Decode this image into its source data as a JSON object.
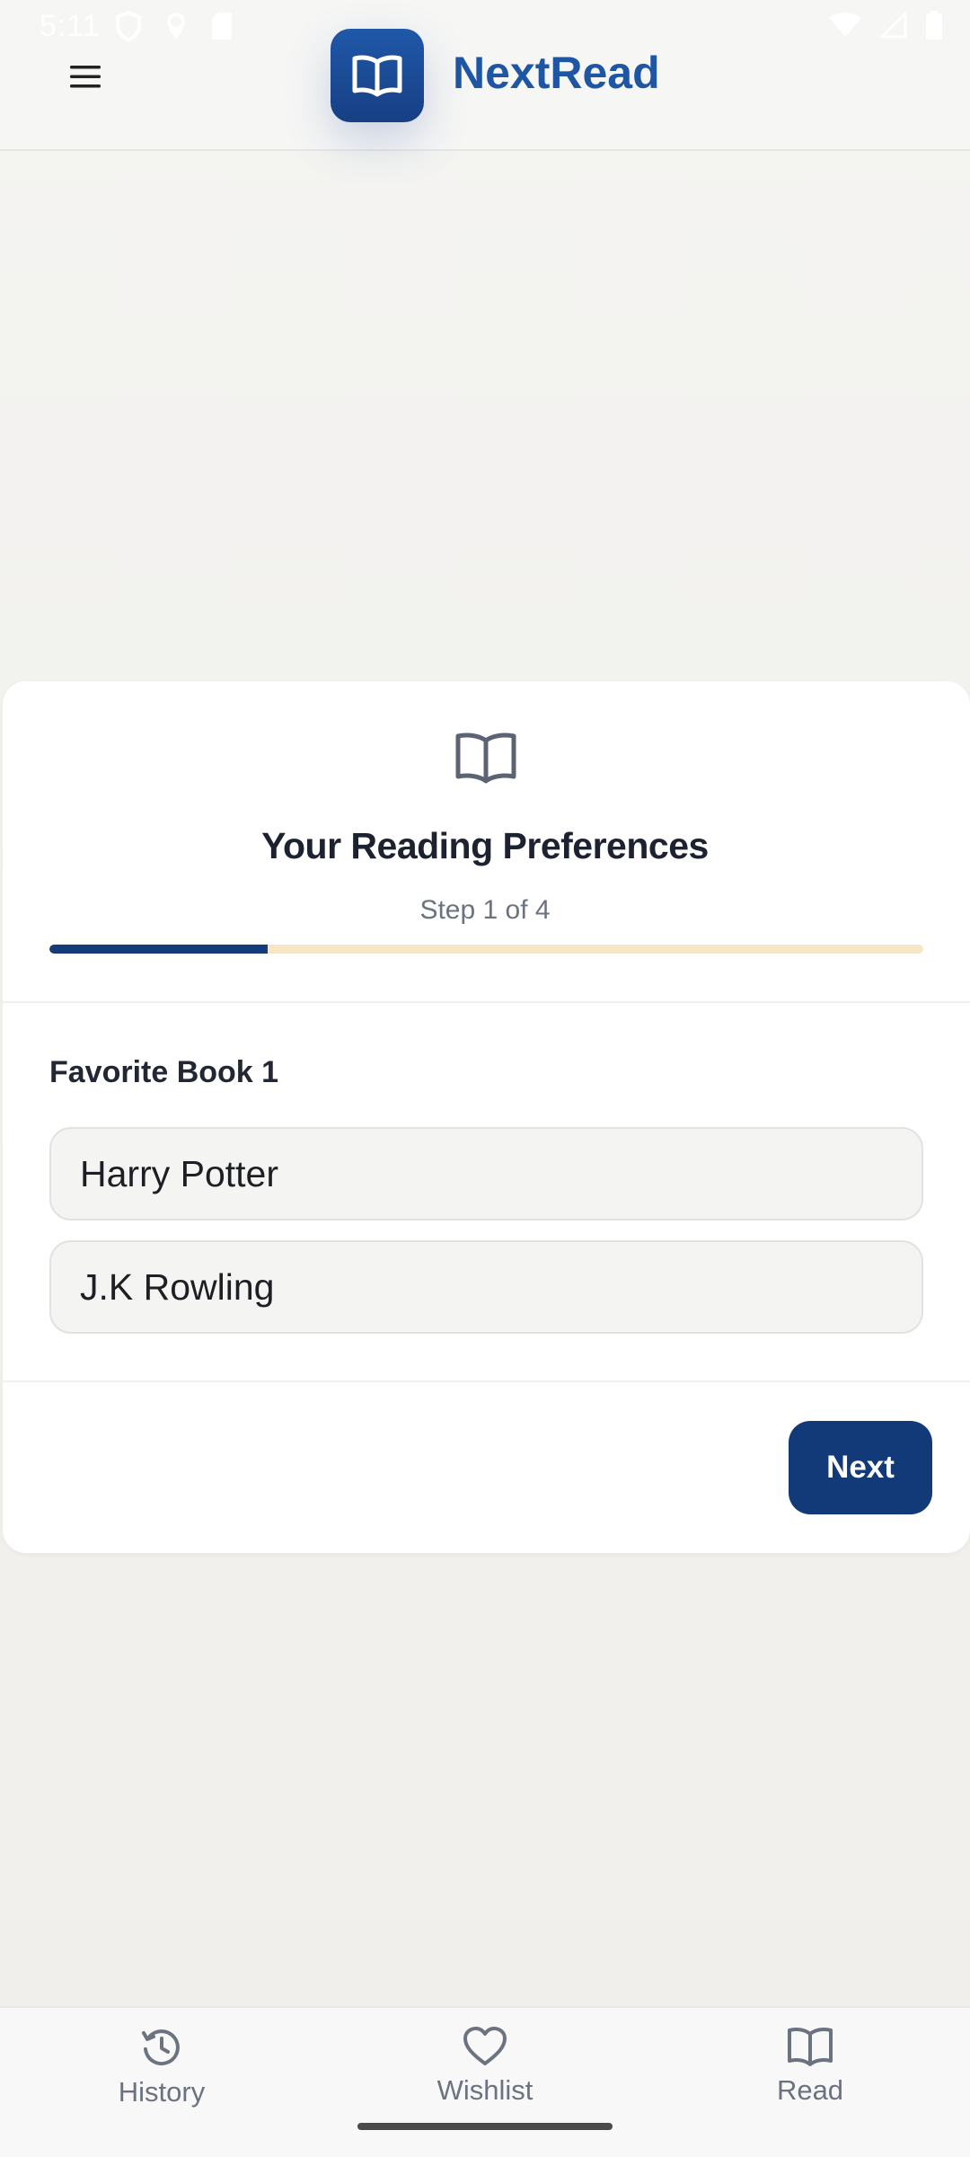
{
  "status_bar": {
    "time": "5:11"
  },
  "header": {
    "app_title": "NextRead",
    "menu_icon": "hamburger-menu-icon",
    "logo_icon": "open-book-icon"
  },
  "card": {
    "icon": "open-book-outline-icon",
    "title": "Your Reading Preferences",
    "step_text": "Step 1 of 4",
    "progress": 0.25,
    "field_label": "Favorite Book 1",
    "book_title_value": "Harry Potter",
    "author_value": "J.K Rowling",
    "next_label": "Next"
  },
  "bottom_nav": {
    "items": [
      {
        "label": "History",
        "icon": "history-icon"
      },
      {
        "label": "Wishlist",
        "icon": "heart-icon"
      },
      {
        "label": "Read",
        "icon": "book-icon"
      }
    ]
  },
  "colors": {
    "brand": "#1f56a4",
    "button": "#133a78",
    "progress_track": "#f6e6c8"
  }
}
